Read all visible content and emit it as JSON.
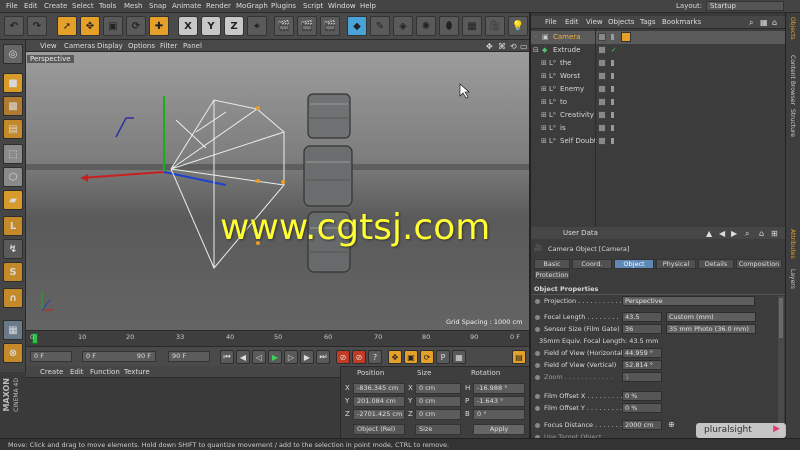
{
  "menubar": {
    "items": [
      "File",
      "Edit",
      "Create",
      "Select",
      "Tools",
      "Mesh",
      "Snap",
      "Animate",
      "Render",
      "MoGraph",
      "Plugins",
      "Script",
      "Window",
      "Help"
    ],
    "layout_label": "Layout:",
    "layout_value": "Startup"
  },
  "toolbar": {
    "xyz": [
      "X",
      "Y",
      "Z"
    ]
  },
  "viewport_menu": {
    "items": [
      "View",
      "Cameras",
      "Display",
      "Options",
      "Filter",
      "Panel"
    ],
    "label": "Perspective",
    "grid_spacing": "Grid Spacing : 1000 cm"
  },
  "timeline": {
    "ticks": [
      "0",
      "10",
      "20",
      "33",
      "40",
      "50",
      "60",
      "70",
      "80",
      "90"
    ],
    "end_label": "0 F"
  },
  "transport": {
    "start_frame": "0 F",
    "current_frame": "0 F",
    "end_frame": "90 F",
    "max_frame": "90 F"
  },
  "material_menu": {
    "items": [
      "Create",
      "Edit",
      "Function",
      "Texture"
    ]
  },
  "coords": {
    "headers": [
      "Position",
      "Size",
      "Rotation"
    ],
    "rows": [
      {
        "axis": "X",
        "pos": "-836.345 cm",
        "size": "0 cm",
        "rot_axis": "H",
        "rot": "-16.988 °"
      },
      {
        "axis": "Y",
        "pos": "201.084 cm",
        "size": "0 cm",
        "rot_axis": "P",
        "rot": "-1.643 °"
      },
      {
        "axis": "Z",
        "pos": "-2701.425 cm",
        "size": "0 cm",
        "rot_axis": "B",
        "rot": "0 °"
      }
    ],
    "mode": "Object (Rel)",
    "size_mode": "Size",
    "apply": "Apply"
  },
  "objects_menu": {
    "items": [
      "File",
      "Edit",
      "View",
      "Objects",
      "Tags",
      "Bookmarks"
    ]
  },
  "objects": [
    {
      "name": "Camera",
      "indent": 0,
      "selected": true
    },
    {
      "name": "Extrude",
      "indent": 0,
      "selected": false
    },
    {
      "name": "the",
      "indent": 1,
      "selected": false
    },
    {
      "name": "Worst",
      "indent": 1,
      "selected": false
    },
    {
      "name": "Enemy",
      "indent": 1,
      "selected": false
    },
    {
      "name": "to",
      "indent": 1,
      "selected": false
    },
    {
      "name": "Creativity",
      "indent": 1,
      "selected": false
    },
    {
      "name": "is",
      "indent": 1,
      "selected": false
    },
    {
      "name": "Self Doubt",
      "indent": 1,
      "selected": false
    }
  ],
  "attributes": {
    "menu_label": "User Data",
    "title": "Camera Object [Camera]",
    "tabs_row1": [
      "Basic",
      "Coord.",
      "Object",
      "Physical",
      "Details",
      "Composition"
    ],
    "tabs_row2": [
      "Protection"
    ],
    "active_tab": "Object",
    "section": "Object Properties",
    "props": [
      {
        "label": "Projection . . . . . . . . . . . .",
        "value": "Perspective",
        "value2": ""
      },
      {
        "label": "Focal Length . . . . . . . .",
        "value": "43.5",
        "value2": "Custom (mm)"
      },
      {
        "label": "Sensor Size (Film Gate)",
        "value": "36",
        "value2": "35 mm Photo (36.0 mm)"
      },
      {
        "label": "35mm Equiv. Focal Length: 43.5 mm",
        "value": "",
        "value2": ""
      },
      {
        "label": "Field of View (Horizontal)",
        "value": "44.959 °",
        "value2": ""
      },
      {
        "label": "Field of View (Vertical)",
        "value": "52.814 °",
        "value2": ""
      },
      {
        "label": "Zoom . . . . . . . . . . . .",
        "value": "1",
        "value2": ""
      },
      {
        "label": "Film Offset X . . . . . . . . .",
        "value": "0 %",
        "value2": ""
      },
      {
        "label": "Film Offset Y . . . . . . . . .",
        "value": "0 %",
        "value2": ""
      },
      {
        "label": "Focus Distance . . . . . . .",
        "value": "2000 cm",
        "value2": ""
      },
      {
        "label": "Use Target Object",
        "value": "",
        "value2": ""
      }
    ]
  },
  "side_tabs": [
    "Objects",
    "Content Browser",
    "Structure",
    "Attributes",
    "Layers"
  ],
  "logo": {
    "line1": "MAXON",
    "line2": "CINEMA 4D"
  },
  "status": "Move: Click and drag to move elements. Hold down SHIFT to quantize movement / add to the selection in point mode, CTRL to remove.",
  "watermark": "www.cgtsj.com",
  "brand": "pluralsight",
  "colors": {
    "accent_orange": "#e5a02a",
    "active_tab": "#5e88b5",
    "watermark": "#ffff33"
  }
}
